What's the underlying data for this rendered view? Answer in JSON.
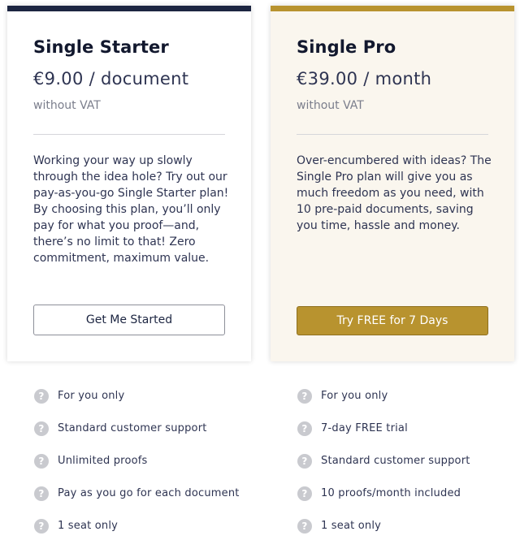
{
  "colors": {
    "navy": "#1c2541",
    "gold": "#b8932f",
    "pro_card_bg": "#faf6ee",
    "help_icon": "#c9cacf"
  },
  "plans": [
    {
      "name": "Single Starter",
      "price": "€9.00 / document",
      "vat": "without VAT",
      "description": "Working your way up slowly through the idea hole? Try out our pay-as-you-go Single Starter plan! By choosing this plan, you’ll only pay for what you proof—and, there’s no limit to that! Zero commitment, maximum value.",
      "button_label": "Get Me Started",
      "features": [
        "For you only",
        "Standard customer support",
        "Unlimited proofs",
        "Pay as you go for each document",
        "1 seat only"
      ]
    },
    {
      "name": "Single Pro",
      "price": "€39.00 / month",
      "vat": "without VAT",
      "description": "Over-encumbered with ideas? The Single Pro plan will give you as much freedom as you need, with 10 pre-paid documents, saving you time, hassle and money.",
      "button_label": "Try FREE for 7 Days",
      "features": [
        "For you only",
        "7-day FREE trial",
        "Standard customer support",
        "10 proofs/month included",
        "1 seat only"
      ]
    }
  ],
  "icons": {
    "help": "?"
  }
}
